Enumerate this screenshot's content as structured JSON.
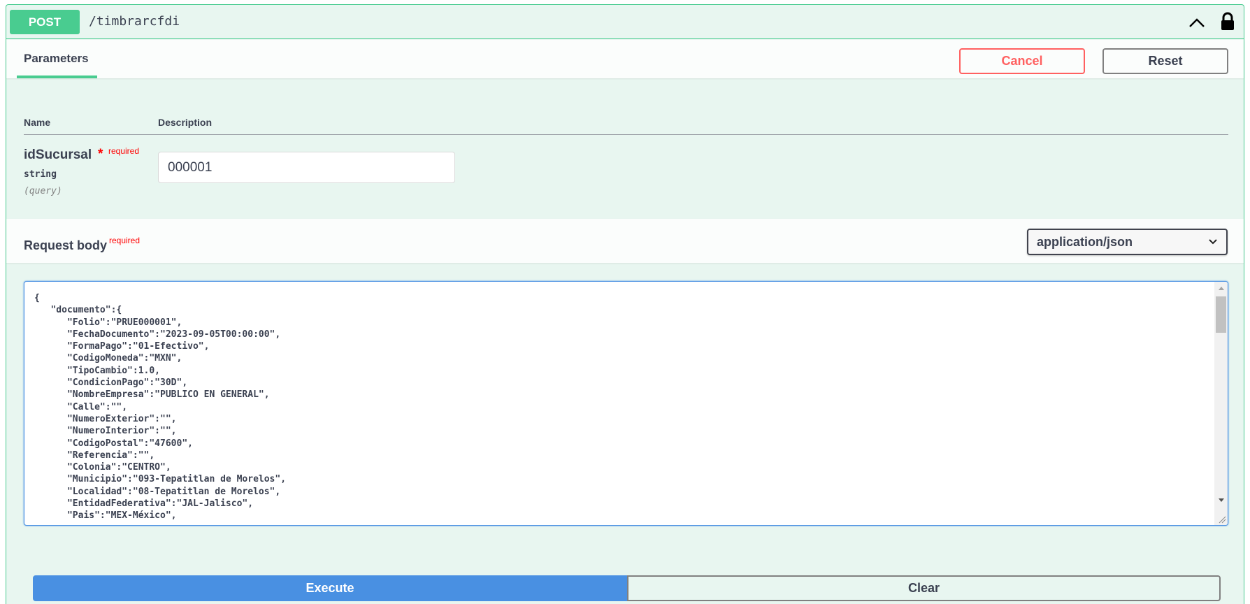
{
  "operation": {
    "method": "POST",
    "path": "/timbrarcfdi"
  },
  "section": {
    "tab_label": "Parameters",
    "cancel_label": "Cancel",
    "reset_label": "Reset"
  },
  "params_table": {
    "col_name": "Name",
    "col_description": "Description",
    "rows": [
      {
        "name": "idSucursal",
        "required_star": "*",
        "required_text": "required",
        "type": "string",
        "in": "(query)",
        "value": "000001"
      }
    ]
  },
  "request_body": {
    "title": "Request body",
    "required_text": "required",
    "content_type": "application/json",
    "content": "{\n   \"documento\":{\n      \"Folio\":\"PRUE000001\",\n      \"FechaDocumento\":\"2023-09-05T00:00:00\",\n      \"FormaPago\":\"01-Efectivo\",\n      \"CodigoMoneda\":\"MXN\",\n      \"TipoCambio\":1.0,\n      \"CondicionPago\":\"30D\",\n      \"NombreEmpresa\":\"PUBLICO EN GENERAL\",\n      \"Calle\":\"\",\n      \"NumeroExterior\":\"\",\n      \"NumeroInterior\":\"\",\n      \"CodigoPostal\":\"47600\",\n      \"Referencia\":\"\",\n      \"Colonia\":\"CENTRO\",\n      \"Municipio\":\"093-Tepatitlan de Morelos\",\n      \"Localidad\":\"08-Tepatitlan de Morelos\",\n      \"EntidadFederativa\":\"JAL-Jalisco\",\n      \"Pais\":\"MEX-México\","
  },
  "actions": {
    "execute_label": "Execute",
    "clear_label": "Clear"
  },
  "icons": {
    "collapse": "chevron-up-icon",
    "auth": "lock-icon",
    "select": "chevron-down-icon"
  },
  "colors": {
    "post": "#49cc90",
    "panel_bg": "#e8f6f0",
    "cancel": "#ff6060",
    "execute": "#4990e2",
    "required": "#ff0000"
  }
}
